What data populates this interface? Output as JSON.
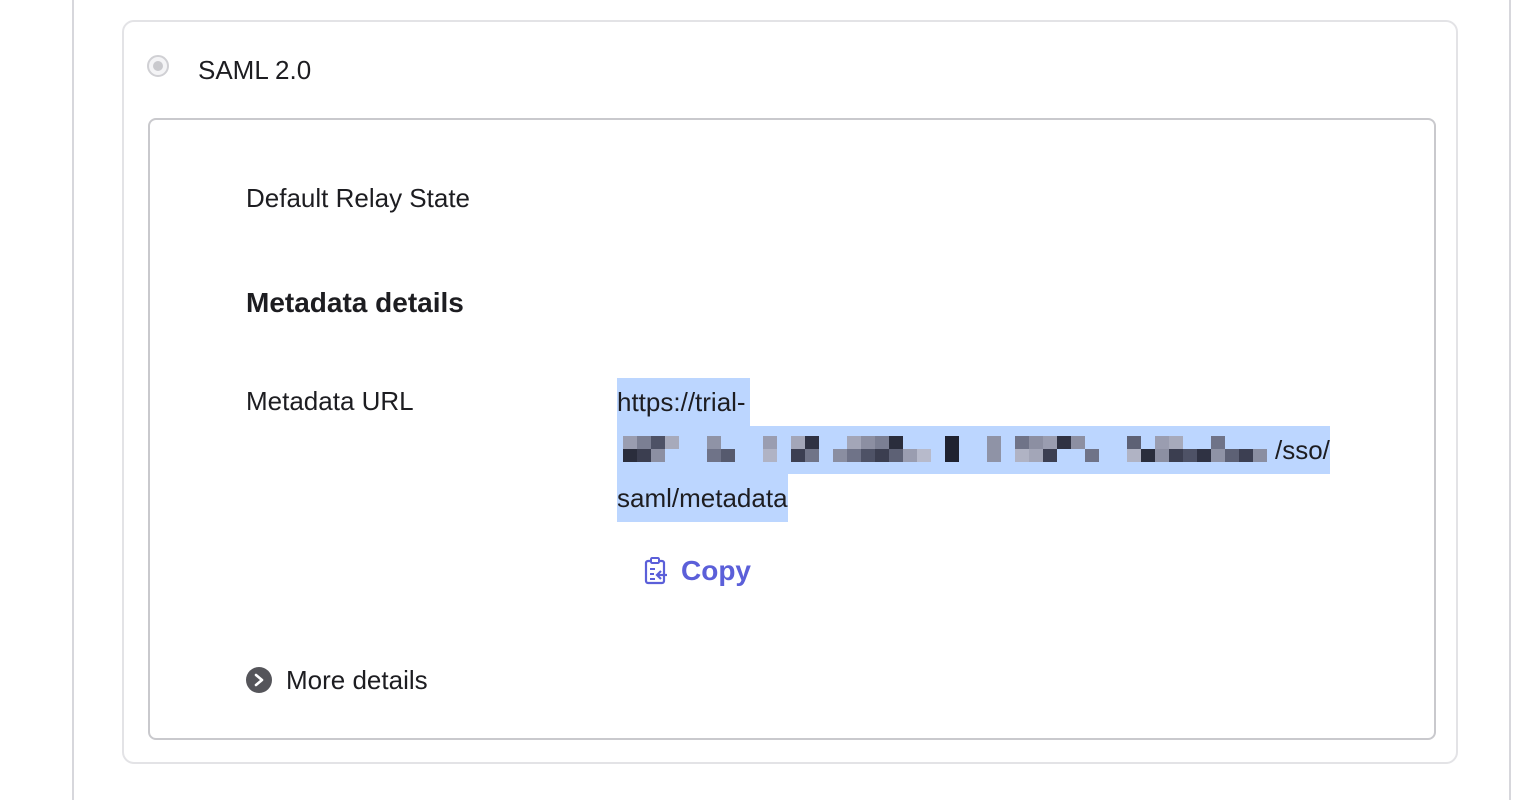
{
  "saml_option": {
    "label": "SAML 2.0",
    "selected": false
  },
  "fields": {
    "default_relay_state_label": "Default Relay State"
  },
  "metadata": {
    "heading": "Metadata details",
    "url_label": "Metadata URL",
    "url_line1": "https://trial-",
    "url_line2_suffix": "/sso/",
    "url_line3": "saml/metadata",
    "url_redacted": true
  },
  "actions": {
    "copy_label": "Copy",
    "copy_icon": "clipboard-copy-icon",
    "more_details_label": "More details",
    "more_details_icon": "chevron-right-circle-icon"
  },
  "colors": {
    "accent": "#5b5fd9",
    "selection": "#bcd6ff",
    "text": "#1d1d21",
    "border": "#c9c9cd"
  }
}
